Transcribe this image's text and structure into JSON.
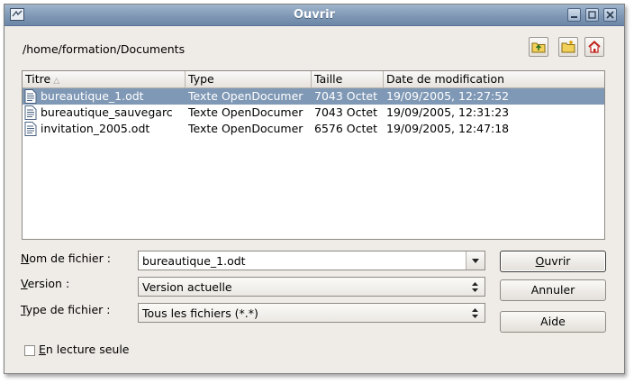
{
  "window": {
    "title": "Ouvrir"
  },
  "location": {
    "path": "/home/formation/Documents"
  },
  "toolbar": {
    "up_icon": "folder-up-icon",
    "new_folder_icon": "new-folder-icon",
    "home_icon": "home-icon"
  },
  "file_list": {
    "columns": [
      "Titre",
      "Type",
      "Taille",
      "Date de modification"
    ],
    "sort_column": "Titre",
    "rows": [
      {
        "name": "bureautique_1.odt",
        "type": "Texte OpenDocumer",
        "size": "7043 Octet",
        "date": "19/09/2005, 12:27:52",
        "selected": true
      },
      {
        "name": "bureautique_sauvegarc",
        "type": "Texte OpenDocumer",
        "size": "7043 Octet",
        "date": "19/09/2005, 12:31:23",
        "selected": false
      },
      {
        "name": "invitation_2005.odt",
        "type": "Texte OpenDocumer",
        "size": "6576 Octet",
        "date": "19/09/2005, 12:47:18",
        "selected": false
      }
    ]
  },
  "form": {
    "filename_label_u": "N",
    "filename_label_rest": "om de fichier :",
    "filename_value": "bureautique_1.odt",
    "version_label_u": "V",
    "version_label_rest": "ersion :",
    "version_value": "Version actuelle",
    "filetype_label_u": "T",
    "filetype_label_rest": "ype de fichier :",
    "filetype_value": "Tous les fichiers (*.*)",
    "readonly_label_u": "E",
    "readonly_label_rest": "n lecture seule",
    "readonly_checked": false
  },
  "buttons": {
    "open_u": "O",
    "open_rest": "uvrir",
    "cancel": "Annuler",
    "help": "Aide"
  },
  "colors": {
    "titlebar": "#7f98b5",
    "selection": "#7f98b5",
    "window_bg": "#efebe7"
  }
}
